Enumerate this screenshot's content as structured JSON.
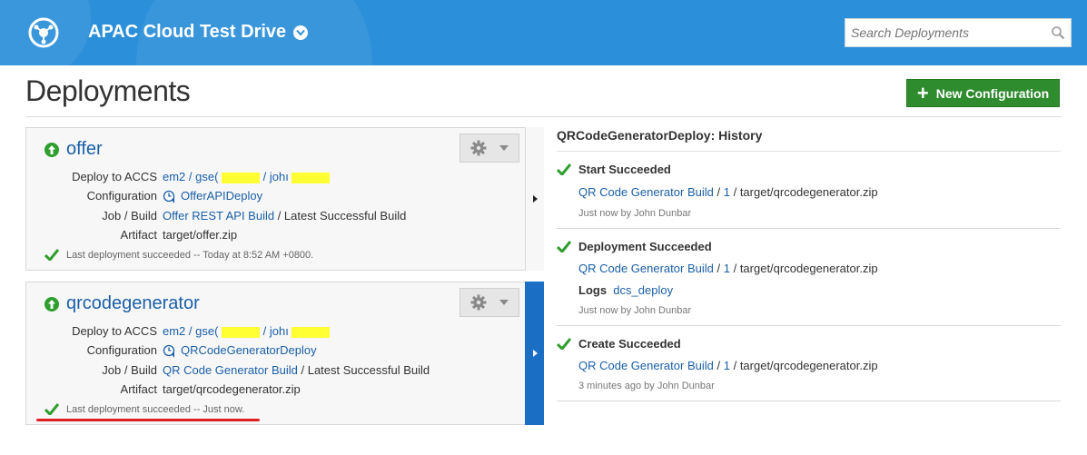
{
  "header": {
    "app_title": "APAC Cloud Test Drive",
    "search_placeholder": "Search Deployments"
  },
  "page": {
    "title": "Deployments",
    "new_config_label": "New Configuration"
  },
  "labels": {
    "deploy_to": "Deploy to ACCS",
    "configuration": "Configuration",
    "job_build": "Job / Build",
    "artifact": "Artifact"
  },
  "deployments": [
    {
      "name": "offer",
      "deploy_prefix": "em2 / gse(",
      "deploy_mid": "/ johı",
      "configuration": "OfferAPIDeploy",
      "job": "Offer REST API Build",
      "build": "/ Latest Successful Build",
      "artifact": "target/offer.zip",
      "status": "Last deployment succeeded -- Today at 8:52 AM +0800."
    },
    {
      "name": "qrcodegenerator",
      "deploy_prefix": "em2 / gse(",
      "deploy_mid": "/ johı",
      "configuration": "QRCodeGeneratorDeploy",
      "job": "QR Code Generator Build",
      "build": "/ Latest Successful Build",
      "artifact": "target/qrcodegenerator.zip",
      "status": "Last deployment succeeded -- Just now."
    }
  ],
  "history": {
    "title": "QRCodeGeneratorDeploy: History",
    "items": [
      {
        "heading": "Start Succeeded",
        "job": "QR Code Generator Build",
        "sep": "/",
        "build_no": "1",
        "artifact": "/ target/qrcodegenerator.zip",
        "meta": "Just now by John Dunbar"
      },
      {
        "heading": "Deployment Succeeded",
        "job": "QR Code Generator Build",
        "sep": "/",
        "build_no": "1",
        "artifact": "/ target/qrcodegenerator.zip",
        "logs_label": "Logs",
        "logs_link": "dcs_deploy",
        "meta": "Just now by John Dunbar"
      },
      {
        "heading": "Create Succeeded",
        "job": "QR Code Generator Build",
        "sep": "/",
        "build_no": "1",
        "artifact": "/ target/qrcodegenerator.zip",
        "meta": "3 minutes ago by John Dunbar"
      }
    ]
  },
  "colors": {
    "header_bg": "#2b8fd9",
    "link": "#1a5fa8",
    "success": "#2e9e2e",
    "button_green": "#2e8b2e",
    "selected": "#1a6fc4"
  }
}
